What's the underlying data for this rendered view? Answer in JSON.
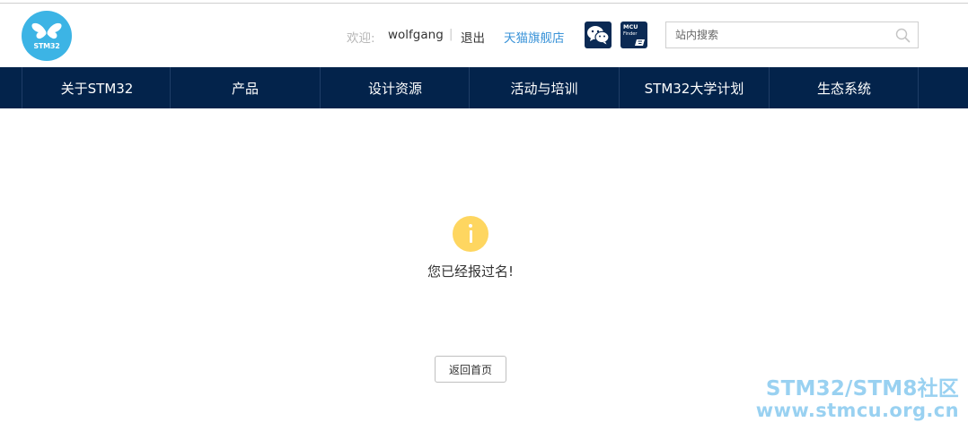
{
  "header": {
    "logo_text": "STM32",
    "welcome_label": "欢迎:",
    "username": "wolfgang",
    "separator": "|",
    "logout_label": "退出",
    "tmall_label": "天猫旗舰店",
    "mcu_finder": {
      "line1": "MCU",
      "line2": "Finder"
    },
    "search": {
      "placeholder": "站内搜索",
      "value": ""
    }
  },
  "nav": {
    "items": [
      {
        "label": "关于STM32"
      },
      {
        "label": "产品"
      },
      {
        "label": "设计资源"
      },
      {
        "label": "活动与培训"
      },
      {
        "label": "STM32大学计划"
      },
      {
        "label": "生态系统"
      }
    ]
  },
  "main": {
    "message": "您已经报过名!",
    "home_button_label": "返回首页"
  },
  "watermark": {
    "line1": "STM32/STM8社区",
    "line2": "www.stmcu.org.cn"
  },
  "colors": {
    "nav_background": "#03234b",
    "logo_blue": "#3cb4e5",
    "info_yellow": "#fed660",
    "tmall_link": "#3a93d8"
  },
  "icons": [
    "butterfly-logo-icon",
    "wechat-icon",
    "mcu-finder-icon",
    "search-icon",
    "info-icon"
  ]
}
